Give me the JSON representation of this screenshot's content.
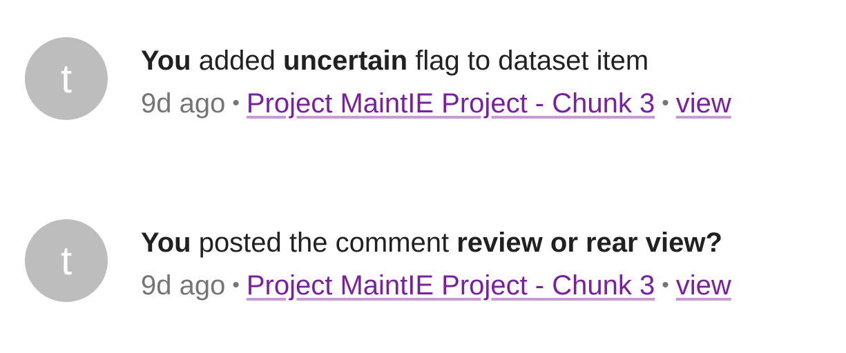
{
  "activities": [
    {
      "avatar_letter": "t",
      "actor": "You",
      "action_before": " added ",
      "target": "uncertain",
      "action_after": " flag to dataset item",
      "time": "9d ago",
      "separator": "•",
      "project_link": "Project MaintIE Project - Chunk 3",
      "view_link": "view"
    },
    {
      "avatar_letter": "t",
      "actor": "You",
      "action_before": " posted the comment ",
      "target": "review or rear view?",
      "action_after": "",
      "time": "9d ago",
      "separator": "•",
      "project_link": "Project MaintIE Project - Chunk 3",
      "view_link": "view"
    }
  ],
  "colors": {
    "avatar_bg": "#bdbdbd",
    "link": "#7b1fa2",
    "meta_text": "#757575",
    "primary_text": "#212121"
  }
}
